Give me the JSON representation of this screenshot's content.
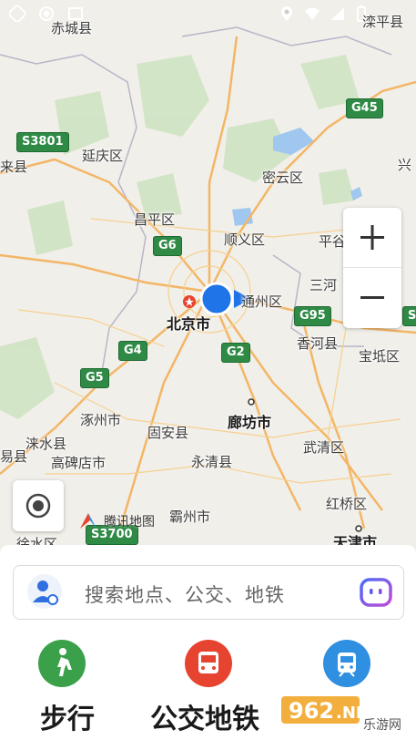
{
  "map": {
    "places": {
      "chicheng": "赤城县",
      "luanping": "滦平县",
      "yanqing": "延庆区",
      "laixian": "来县",
      "miyun": "密云区",
      "xingl": "兴",
      "changping": "昌平区",
      "shunyi": "顺义区",
      "pinggu": "平谷",
      "sanhe": "三河",
      "tongzhou": "通州区",
      "beijing": "北京市",
      "xianghe": "香河县",
      "baodi": "宝坻区",
      "zhuozhou": "涿州市",
      "guan": "固安县",
      "langfang": "廊坊市",
      "wuqing": "武清区",
      "laishui": "涞水县",
      "gaobeidian": "高碑店市",
      "yongqing": "永清县",
      "yixian": "易县",
      "bazhou": "霸州市",
      "hongqiao": "红桥区",
      "tianjin": "天津市",
      "xushui": "徐水区"
    },
    "shields": {
      "g45": "G45",
      "s3801": "S3801",
      "g6": "G6",
      "g95": "G95",
      "g4": "G4",
      "g2": "G2",
      "g5": "G5",
      "s3700": "S3700",
      "s_right": "S"
    },
    "zoom_in": "+",
    "zoom_out": "−",
    "brand": "腾讯地图"
  },
  "search": {
    "placeholder": "搜索地点、公交、地铁"
  },
  "actions": {
    "walk": "步行",
    "transit": "公交地铁"
  },
  "colors": {
    "walk": "#3aa14a",
    "transit": "#e64431",
    "subway": "#2f8fe0",
    "location": "#1f74e8"
  },
  "watermark": "乐游网"
}
